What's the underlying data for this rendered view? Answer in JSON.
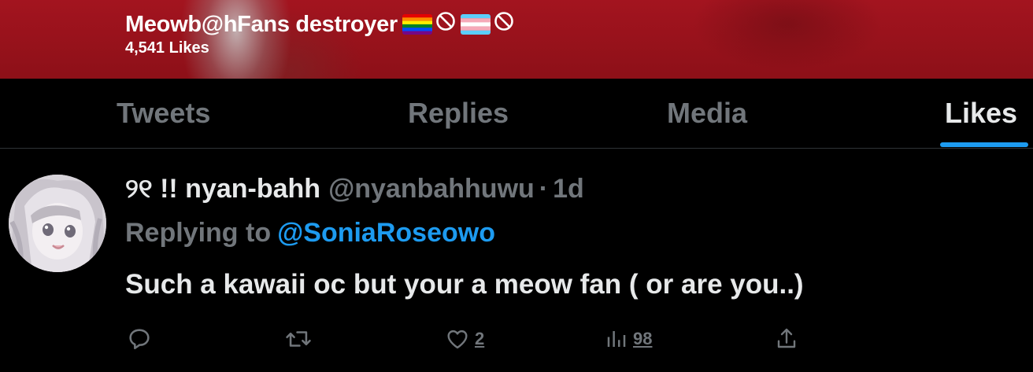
{
  "profile_header": {
    "name": "Meowb@hFans destroyer",
    "emoji": [
      "rainbow-flag",
      "prohibited-sign",
      "transgender-flag",
      "prohibited-sign"
    ],
    "likes_count": "4,541 Likes"
  },
  "tabs": [
    {
      "label": "Tweets",
      "active": false
    },
    {
      "label": "Replies",
      "active": false
    },
    {
      "label": "Media",
      "active": false
    },
    {
      "label": "Likes",
      "active": true
    }
  ],
  "tweet": {
    "display_name": "୨୧ !! nyan-bahh",
    "handle": "@nyanbahhuwu",
    "separator": "·",
    "time": "1d",
    "replying_prefix": "Replying to",
    "replying_to": "@SoniaRoseowo",
    "text": "Such a kawaii oc but your a meow fan ( or are you..)",
    "actions": {
      "reply_icon": "reply-icon",
      "retweet_icon": "retweet-icon",
      "like_icon": "heart-icon",
      "like_count": "2",
      "views_icon": "views-icon",
      "views_count": "98",
      "share_icon": "share-icon"
    }
  },
  "colors": {
    "banner": "#a3141f",
    "background": "#000000",
    "primary_text": "#e7e9ea",
    "secondary_text": "#71767b",
    "accent": "#1d9bf0",
    "divider": "#2f3336"
  }
}
